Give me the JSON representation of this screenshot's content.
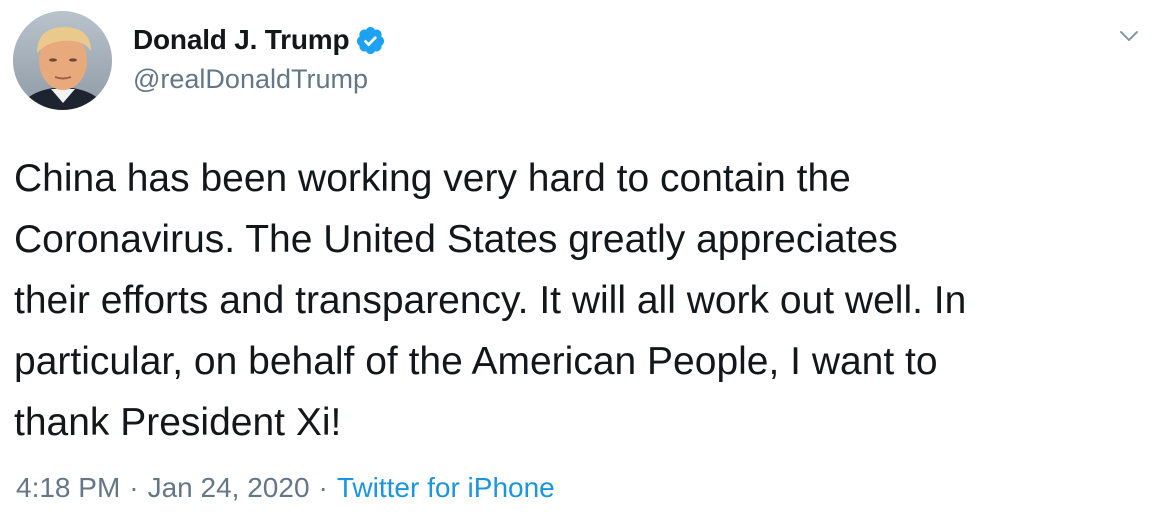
{
  "author": {
    "display_name": "Donald J. Trump",
    "handle": "@realDonaldTrump",
    "verified": true,
    "verified_color": "#1da1f2"
  },
  "tweet": {
    "text": "China has been working very hard to contain the\nCoronavirus. The United States greatly appreciates\ntheir efforts and transparency. It will all work out well. In\nparticular, on behalf of the American People, I want to\nthank President Xi!"
  },
  "meta": {
    "time": "4:18 PM",
    "separator_1": "·",
    "date": "Jan 24, 2020",
    "separator_2": "·",
    "source": "Twitter for iPhone"
  },
  "icons": {
    "more": "chevron-down-icon",
    "verified": "verified-badge-icon"
  },
  "colors": {
    "text": "#14171a",
    "secondary": "#657786",
    "link": "#1b95e0"
  }
}
